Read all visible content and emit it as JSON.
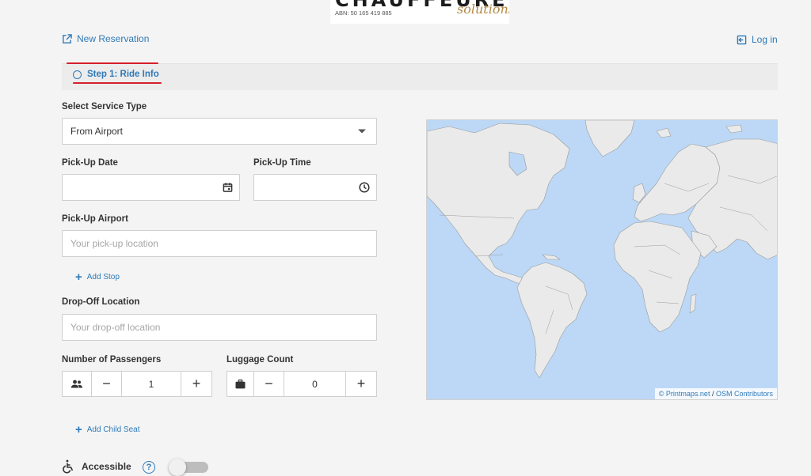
{
  "logo": {
    "brand": "CHAUFFEURED",
    "abn": "ABN: 50 165 419 885",
    "solutions": "solutions"
  },
  "header": {
    "new_reservation": "New Reservation",
    "login": "Log in"
  },
  "steps": [
    {
      "label": "Step 1: Ride Info",
      "active": true
    }
  ],
  "form": {
    "service_type": {
      "label": "Select Service Type",
      "value": "From Airport"
    },
    "pickup_date": {
      "label": "Pick-Up Date",
      "icon": "calendar-icon"
    },
    "pickup_time": {
      "label": "Pick-Up Time",
      "icon": "clock-icon"
    },
    "pickup_airport": {
      "label": "Pick-Up Airport",
      "placeholder": "Your pick-up location"
    },
    "add_stop": "Add Stop",
    "dropoff": {
      "label": "Drop-Off Location",
      "placeholder": "Your drop-off location"
    },
    "passengers": {
      "label": "Number of Passengers",
      "value": "1",
      "icon": "people-icon"
    },
    "luggage": {
      "label": "Luggage Count",
      "value": "0",
      "icon": "suitcase-icon"
    },
    "add_child_seat": "Add Child Seat",
    "accessible": {
      "label": "Accessible",
      "help": "?",
      "enabled": false
    }
  },
  "map": {
    "attribution_printmaps": "© Printmaps.net",
    "attribution_sep": " / ",
    "attribution_osm": "OSM Contributors",
    "water_color": "#bcd8f6",
    "land_color": "#eaeaea"
  },
  "colors": {
    "accent": "#2f7ab8",
    "underline": "#d61f2a",
    "background": "#f4f4f4"
  }
}
